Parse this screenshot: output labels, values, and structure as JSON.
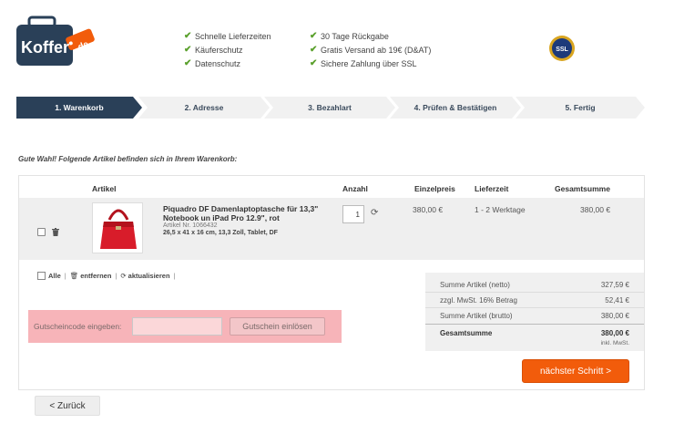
{
  "header": {
    "logo_text": "Koffer",
    "logo_tag": ".de",
    "usps_left": [
      "Schnelle Lieferzeiten",
      "Käuferschutz",
      "Datenschutz"
    ],
    "usps_right": [
      "30 Tage Rückgabe",
      "Gratis Versand ab 19€ (D&AT)",
      "Sichere Zahlung über SSL"
    ],
    "ssl_badge": "SSL"
  },
  "steps": [
    "1. Warenkorb",
    "2. Adresse",
    "3. Bezahlart",
    "4. Prüfen & Bestätigen",
    "5. Fertig"
  ],
  "intro": "Gute Wahl! Folgende Artikel befinden sich in Ihrem Warenkorb:",
  "table": {
    "headers": {
      "article": "Artikel",
      "qty": "Anzahl",
      "unit_price": "Einzelpreis",
      "delivery": "Lieferzeit",
      "total": "Gesamtsumme"
    },
    "item": {
      "name": "Piquadro DF Damenlaptoptasche für 13,3\" Notebook un iPad Pro 12.9\", rot",
      "number": "Artikel Nr. 1066432",
      "dims": "26,5 x 41 x 16 cm, 13,3 Zoll, Tablet, DF",
      "qty": "1",
      "unit_price": "380,00 €",
      "delivery": "1 - 2 Werktage",
      "total": "380,00 €"
    }
  },
  "actions": {
    "all": "Alle",
    "remove": "entfernen",
    "update": "aktualisieren"
  },
  "coupon": {
    "label": "Gutscheincode eingeben:",
    "value": "",
    "button": "Gutschein einlösen"
  },
  "summary": {
    "net_label": "Summe Artikel (netto)",
    "net": "327,59 €",
    "vat_label": "zzgl. MwSt. 16% Betrag",
    "vat": "52,41 €",
    "gross_label": "Summe Artikel (brutto)",
    "gross": "380,00 €",
    "total_label": "Gesamtsumme",
    "total": "380,00 €",
    "incl": "inkl. MwSt."
  },
  "next_button": "nächster Schritt >",
  "back_button": "< Zurück",
  "colors": {
    "brand_blue": "#2a4058",
    "accent_orange": "#f25c0b",
    "check_green": "#5aa02c",
    "coupon_highlight": "#f7b4b9"
  }
}
